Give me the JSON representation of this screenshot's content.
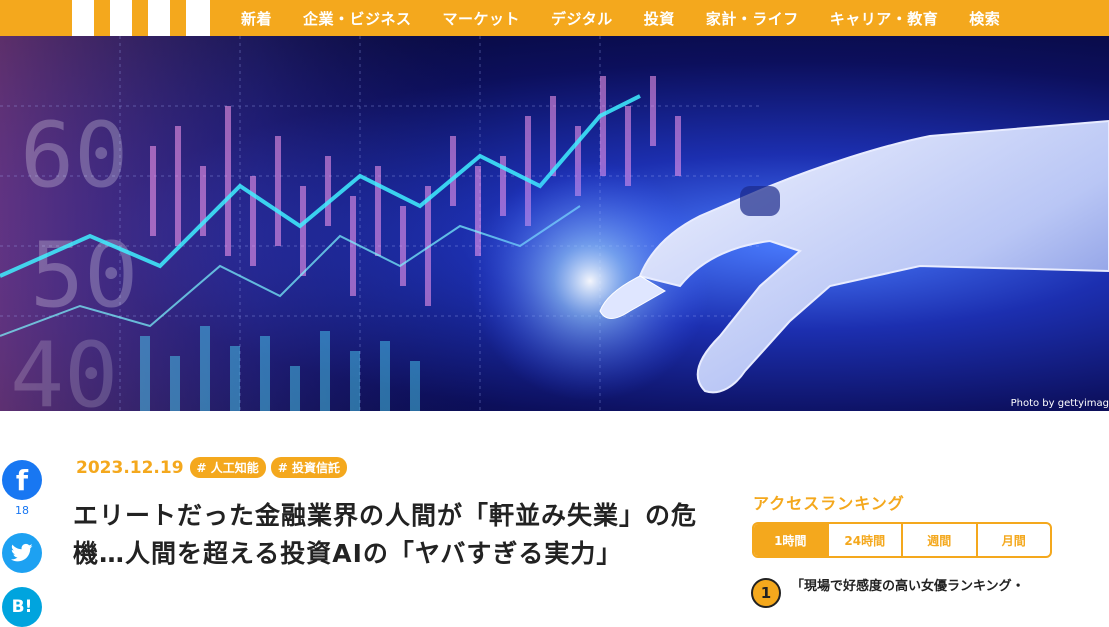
{
  "nav": {
    "items": [
      "新着",
      "企業・ビジネス",
      "マーケット",
      "デジタル",
      "投資",
      "家計・ライフ",
      "キャリア・教育",
      "検索"
    ]
  },
  "hero": {
    "credit": "Photo by gettyimag"
  },
  "share": {
    "facebook_count": "18"
  },
  "article": {
    "date": "2023.12.19",
    "tags": [
      "# 人工知能",
      "# 投資信託"
    ],
    "title": "エリートだった金融業界の人間が「軒並み失業」の危機…人間を超える投資AIの「ヤバすぎる実力」"
  },
  "ranking": {
    "heading": "アクセスランキング",
    "tabs": [
      "1時間",
      "24時間",
      "週間",
      "月間"
    ],
    "items": [
      {
        "rank": "1",
        "text": "「現場で好感度の高い女優ランキング・"
      }
    ]
  },
  "colors": {
    "accent": "#f4a81d",
    "facebook": "#1877f2",
    "twitter": "#1da1f2",
    "hatena": "#00a4de"
  }
}
